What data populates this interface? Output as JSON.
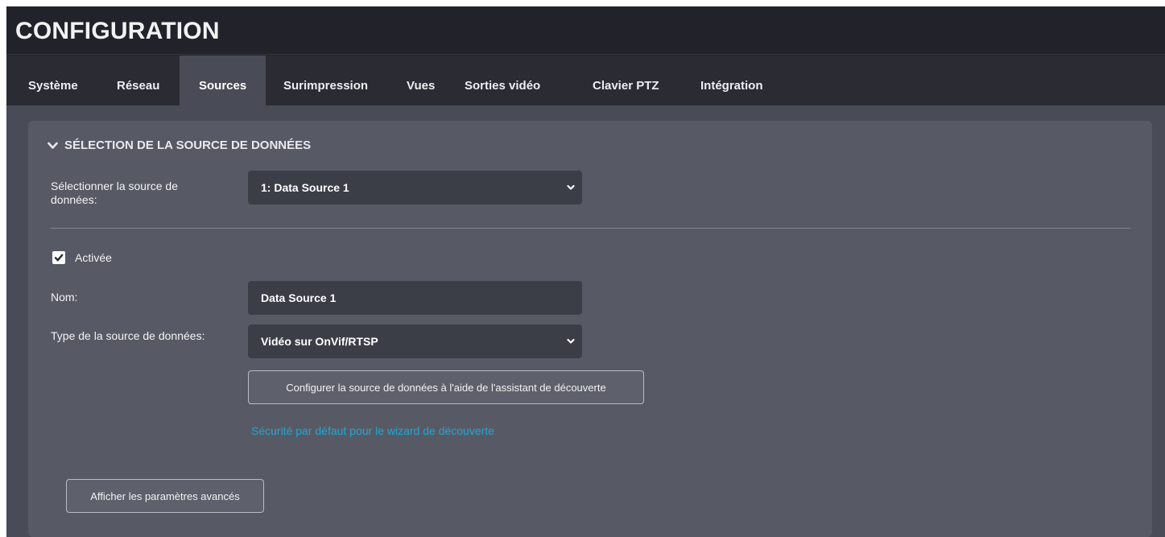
{
  "header": {
    "title": "CONFIGURATION"
  },
  "tabs": [
    {
      "label": "Système"
    },
    {
      "label": "Réseau"
    },
    {
      "label": "Sources"
    },
    {
      "label": "Surimpression"
    },
    {
      "label": "Vues"
    },
    {
      "label": "Sorties vidéo"
    },
    {
      "label": "Clavier PTZ"
    },
    {
      "label": "Intégration"
    }
  ],
  "active_tab": "Sources",
  "section": {
    "title": "SÉLECTION DE LA SOURCE DE DONNÉES",
    "select_source_label": "Sélectionner la source de données:",
    "select_source_value": "1: Data Source 1",
    "enabled_label": "Activée",
    "enabled_checked": true,
    "name_label": "Nom:",
    "name_value": "Data Source 1",
    "type_label": "Type de la source de données:",
    "type_value": "Vidéo sur OnVif/RTSP",
    "discovery_button": "Configurer la source de données à l'aide de l'assistant de découverte",
    "security_link": "Sécurité par défaut pour le wizard de découverte",
    "advanced_button": "Afficher les paramètres avancés"
  },
  "colors": {
    "accent_link": "#20a7d4",
    "page_bg": "#23242a",
    "panel_bg": "#575a65",
    "field_bg": "#3c3e47"
  }
}
